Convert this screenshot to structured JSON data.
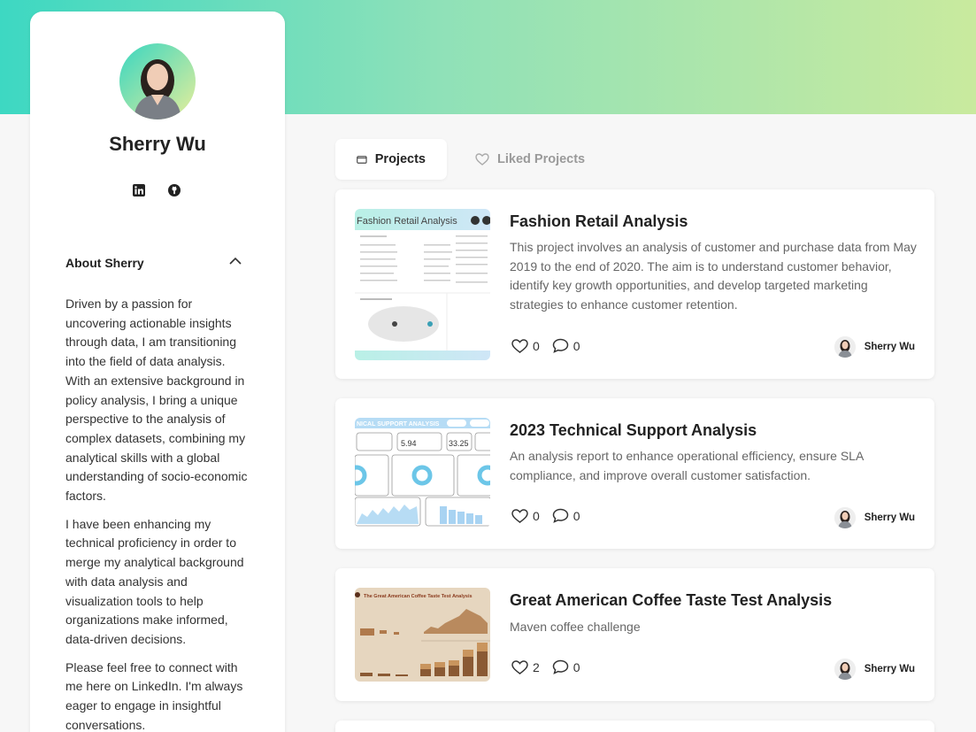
{
  "profile": {
    "name": "Sherry Wu",
    "social": [
      "linkedin-icon",
      "github-icon"
    ]
  },
  "about": {
    "title": "About Sherry",
    "paragraphs": [
      "Driven by a passion for uncovering actionable insights through data, I am transitioning into the field of data analysis. With an extensive background in policy analysis, I bring a unique perspective to the analysis of complex datasets, combining my analytical skills with a global understanding of socio-economic factors.",
      "I have been enhancing my technical proficiency in order to merge my analytical background with data analysis and visualization tools to help organizations make informed, data-driven decisions.",
      "Please feel free to connect with me here on LinkedIn. I'm always eager to engage in insightful conversations."
    ]
  },
  "tabs": {
    "projects": "Projects",
    "liked": "Liked Projects"
  },
  "projects": [
    {
      "title": "Fashion Retail Analysis",
      "description": "This project involves an analysis of customer and purchase data from May 2019 to the end of 2020. The aim is to understand customer behavior, identify key growth opportunities, and develop targeted marketing strategies to enhance customer retention.",
      "likes": "0",
      "comments": "0",
      "author": "Sherry Wu",
      "thumb_title": "Fashion Retail Analysis"
    },
    {
      "title": "2023 Technical Support Analysis",
      "description": "An analysis report to enhance operational efficiency, ensure SLA compliance, and improve overall customer satisfaction.",
      "likes": "0",
      "comments": "0",
      "author": "Sherry Wu",
      "thumb_title": "NICAL SUPPORT ANALYSIS",
      "thumb_kpi": [
        "5.94",
        "33.25"
      ]
    },
    {
      "title": "Great American Coffee Taste Test Analysis",
      "description": "Maven coffee challenge",
      "likes": "2",
      "comments": "0",
      "author": "Sherry Wu",
      "thumb_title": "The Great American Coffee Taste Test Analysis"
    }
  ],
  "colors": {
    "banner_start": "#3dd8c2",
    "banner_end": "#c9ea9e"
  }
}
